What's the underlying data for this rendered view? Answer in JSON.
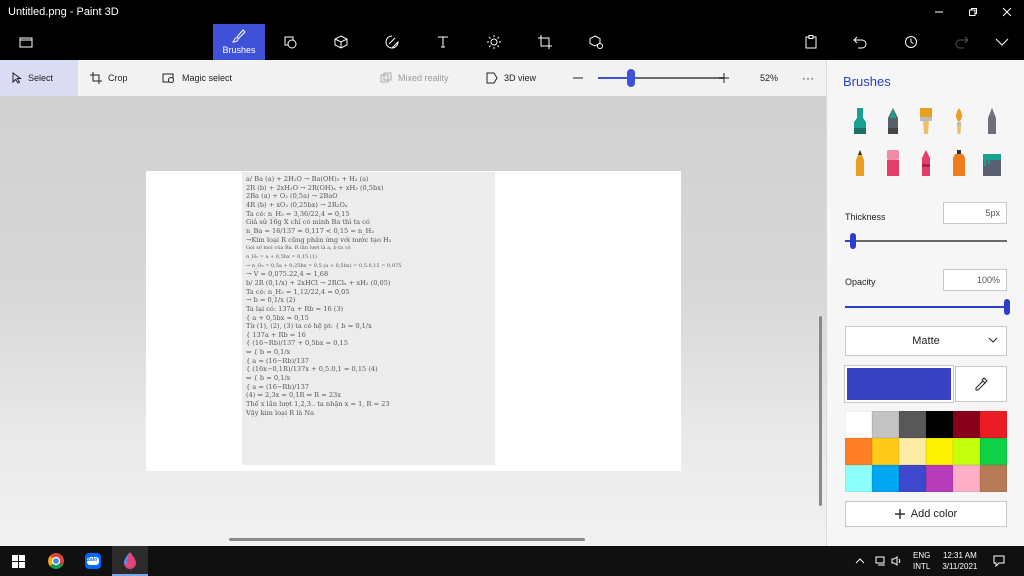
{
  "window": {
    "title": "Untitled.png - Paint 3D",
    "controls": [
      "minimize",
      "maximize",
      "close"
    ]
  },
  "toolbar": {
    "tools": [
      {
        "name": "brushes",
        "label": "Brushes",
        "icon": "brush-icon",
        "active": true
      },
      {
        "name": "2d-shapes",
        "icon": "2d-shapes-icon"
      },
      {
        "name": "3d-shapes",
        "icon": "3d-cube-icon"
      },
      {
        "name": "stickers",
        "icon": "sticker-icon"
      },
      {
        "name": "text",
        "icon": "text-icon"
      },
      {
        "name": "effects",
        "icon": "effects-icon"
      },
      {
        "name": "canvas",
        "icon": "canvas-icon"
      },
      {
        "name": "3d-library",
        "icon": "3d-library-icon"
      }
    ],
    "right": [
      "paste-icon",
      "undo-icon",
      "history-icon",
      "redo-icon",
      "expand-chevron-icon"
    ]
  },
  "subtoolbar": {
    "select_label": "Select",
    "crop_label": "Crop",
    "magic_select_label": "Magic select",
    "mixed_reality_label": "Mixed reality",
    "view3d_label": "3D view",
    "zoom_percent": "52%",
    "zoom_level": 0.26,
    "more_label": "···"
  },
  "document": {
    "lines": [
      {
        "text": "a/ Ba (a) + 2H₂O → Ba(OH)₂ + H₂ (a)",
        "small": false
      },
      {
        "text": "2R (b) + 2xH₂O → 2R(OH)ₓ + xH₂ (0,5bx)",
        "small": false
      },
      {
        "text": "2Ba (a) + O₂ (0,5a) → 2BaO",
        "small": false
      },
      {
        "text": "4R (b) + xO₂ (0,25bx) → 2R₂Oₓ",
        "small": false
      },
      {
        "text": "Ta có: n_H₂ = 3,36/22,4 = 0,15",
        "small": false
      },
      {
        "text": "Giả sử 16g X chỉ có mình Ba thì ta có",
        "small": false
      },
      {
        "text": "n_Ba = 16/137 ≈ 0,117 < 0,15 = n_H₂",
        "small": false
      },
      {
        "text": "→Kim loại R cũng phản ứng với nước tạo H₂",
        "small": false
      },
      {
        "text": "Gọi số mol của Ba, R lần lượt là a, b ta có",
        "small": true
      },
      {
        "text": "n_H₂ = a + 0,5bx = 0,15 (1)",
        "small": true
      },
      {
        "text": "→ n_O₂ = 0,5a + 0,25bx = 0,5 (a + 0,5bx) = 0,5.0,15 = 0,075",
        "small": true
      },
      {
        "text": "→ V = 0,075.22,4 = 1,68",
        "small": false
      },
      {
        "text": "b/ 2R (0,1/x) + 2xHCl → 2RClₓ + xH₂ (0,05)",
        "small": false
      },
      {
        "text": "Ta có: n_H₂ = 1,12/22,4 = 0,05",
        "small": false
      },
      {
        "text": "→ b = 0,1/x (2)",
        "small": false
      },
      {
        "text": "Ta lại có: 137a + Rb = 16 (3)",
        "small": false
      },
      {
        "text": "               { a + 0,5bx = 0,15",
        "small": false
      },
      {
        "text": "Từ (1), (2), (3) ta có hệ pt: {  b = 0,1/x",
        "small": false
      },
      {
        "text": "               { 137a + Rb = 16",
        "small": false
      },
      {
        "text": "    { (16−Rb)/137 + 0,5bx = 0,15",
        "small": false
      },
      {
        "text": "⇔ {        b = 0,1/x",
        "small": false
      },
      {
        "text": "    {      a = (16−Rb)/137",
        "small": false
      },
      {
        "text": "    { (16x−0,1R)/137x + 0,5.0,1 = 0,15 (4)",
        "small": false
      },
      {
        "text": "⇔ {        b = 0,1/x",
        "small": false
      },
      {
        "text": "    {      a = (16−Rb)/137",
        "small": false
      },
      {
        "text": "(4) ⇔ 2,3x = 0,1R ⇔ R = 23x",
        "small": false
      },
      {
        "text": "Thế x lần lượt 1,2,3.. ta nhận x = 1, R = 23",
        "small": false
      },
      {
        "text": "Vậy kim loại R là Na",
        "small": false
      }
    ]
  },
  "panel": {
    "title": "Brushes",
    "brushes": [
      {
        "name": "marker",
        "color": "#1aa091"
      },
      {
        "name": "calligraphy-pen",
        "color": "#1aa091"
      },
      {
        "name": "oil-brush",
        "color": "#e8a020"
      },
      {
        "name": "watercolor",
        "color": "#e8a020"
      },
      {
        "name": "pixel-pen",
        "color": "#6a6f7a"
      },
      {
        "name": "pencil",
        "color": "#e8a020"
      },
      {
        "name": "eraser",
        "color": "#e33d6a"
      },
      {
        "name": "crayon",
        "color": "#e33d6a"
      },
      {
        "name": "spray-can",
        "color": "#f07c1c"
      },
      {
        "name": "fill",
        "color": "#1aa091"
      }
    ],
    "thickness_label": "Thickness",
    "thickness_value": "5px",
    "thickness_level": 0.05,
    "opacity_label": "Opacity",
    "opacity_value": "100%",
    "opacity_level": 1.0,
    "finish_value": "Matte",
    "current_color": "#3a42c4",
    "palette": [
      "#ffffff",
      "#c3c3c3",
      "#585858",
      "#000000",
      "#88001b",
      "#ec1c24",
      "#ff7f27",
      "#ffca18",
      "#fdeca6",
      "#fff200",
      "#c4ff0e",
      "#0ed145",
      "#8cfffb",
      "#00a8f3",
      "#3f48cc",
      "#b83dba",
      "#ffaec8",
      "#b97a56"
    ],
    "add_color_label": "Add color"
  },
  "taskbar": {
    "apps": [
      "windows-start-icon",
      "chrome-icon",
      "zalo-icon",
      "paint3d-icon"
    ],
    "zalo_label": "Zalo",
    "lang_top": "ENG",
    "lang_bottom": "INTL",
    "time": "12:31 AM",
    "date": "3/11/2021"
  }
}
